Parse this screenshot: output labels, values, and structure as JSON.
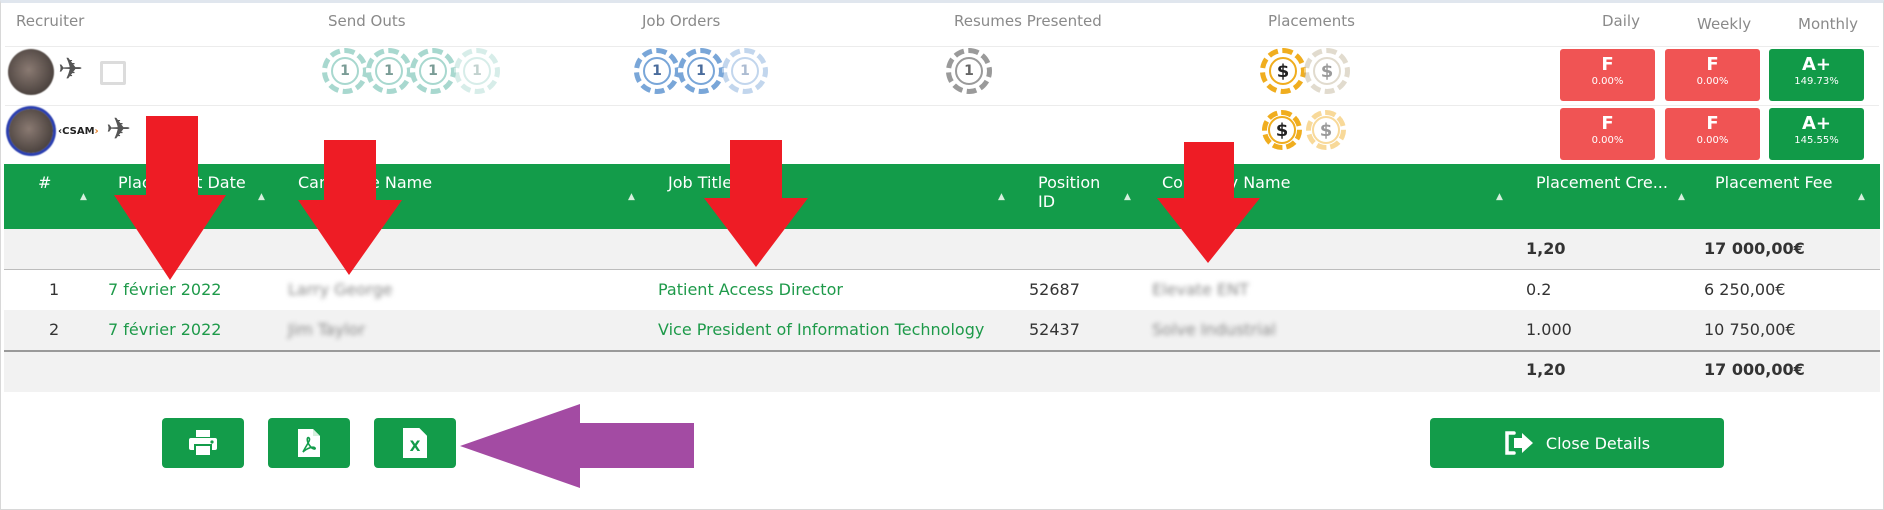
{
  "recruiter_header": {
    "recruiter": "Recruiter",
    "send_outs": "Send Outs",
    "job_orders": "Job Orders",
    "resumes_presented": "Resumes Presented",
    "placements": "Placements",
    "daily": "Daily",
    "weekly": "Weekly",
    "monthly": "Monthly"
  },
  "recruiters": [
    {
      "chip_value": "1",
      "placement_symbol": "$",
      "daily": {
        "grade": "F",
        "pct": "0.00%"
      },
      "weekly": {
        "grade": "F",
        "pct": "0.00%"
      },
      "monthly": {
        "grade": "A+",
        "pct": "149.73%"
      }
    },
    {
      "logo_text": "CSAM",
      "placement_symbol": "$",
      "daily": {
        "grade": "F",
        "pct": "0.00%"
      },
      "weekly": {
        "grade": "F",
        "pct": "0.00%"
      },
      "monthly": {
        "grade": "A+",
        "pct": "145.55%"
      }
    }
  ],
  "table": {
    "columns": [
      "#",
      "Placement Date",
      "Candidate Name",
      "Job Title",
      "Position ID",
      "Company Name",
      "Placement Cre...",
      "Placement Fee"
    ],
    "column_lines": {
      "position_line1": "Position",
      "position_line2": "ID"
    },
    "sort_glyph": "▲",
    "summary_top": {
      "credit": "1,20",
      "fee": "17 000,00€"
    },
    "rows": [
      {
        "num": "1",
        "date": "7 février 2022",
        "candidate": "Larry George",
        "job_title": "Patient Access Director",
        "position_id": "52687",
        "company": "Elevate ENT",
        "credit": "0.2",
        "fee": "6 250,00€"
      },
      {
        "num": "2",
        "date": "7 février 2022",
        "candidate": "Jim Taylor",
        "job_title": "Vice President of Information Technology",
        "position_id": "52437",
        "company": "Solve Industrial",
        "credit": "1.000",
        "fee": "10 750,00€"
      }
    ],
    "summary_bottom": {
      "credit": "1,20",
      "fee": "17 000,00€"
    }
  },
  "buttons": {
    "print_icon": "printer-icon",
    "pdf_icon": "pdf-file-icon",
    "excel_icon": "excel-file-icon",
    "excel_glyph": "X",
    "close_label": "Close Details"
  },
  "colors": {
    "header_green": "#139c4a",
    "grade_red": "#f05454",
    "grade_green": "#119a48",
    "annotation_red": "#ee1c25",
    "annotation_purple": "#a34ba3"
  }
}
